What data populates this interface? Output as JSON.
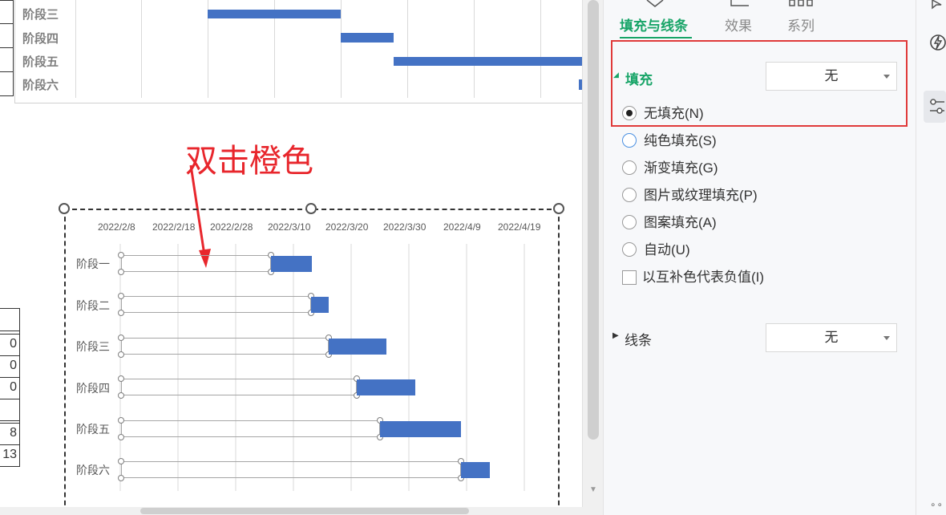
{
  "top_chart": {
    "labels": [
      "阶段三",
      "阶段四",
      "阶段五",
      "阶段六"
    ]
  },
  "sheet": {
    "values": [
      "0",
      "0",
      "0",
      "8",
      "13"
    ]
  },
  "annotation": {
    "text": "双击橙色"
  },
  "chart": {
    "x_ticks": [
      "2022/2/8",
      "2022/2/18",
      "2022/2/28",
      "2022/3/10",
      "2022/3/20",
      "2022/3/30",
      "2022/4/9",
      "2022/4/19"
    ],
    "y_labels": [
      "阶段一",
      "阶段二",
      "阶段三",
      "阶段四",
      "阶段五",
      "阶段六"
    ]
  },
  "chart_data": {
    "type": "bar",
    "orientation": "horizontal stacked (gantt)",
    "categories": [
      "阶段一",
      "阶段二",
      "阶段三",
      "阶段四",
      "阶段五",
      "阶段六"
    ],
    "x_ticks": [
      "2022/2/8",
      "2022/2/18",
      "2022/2/28",
      "2022/3/10",
      "2022/3/20",
      "2022/3/30",
      "2022/4/9",
      "2022/4/19"
    ],
    "xlim": [
      "2022/2/8",
      "2022/4/25"
    ],
    "series": [
      {
        "values": [
          "2022/3/6",
          "2022/3/13",
          "2022/3/16",
          "2022/3/21",
          "2022/3/25",
          "2022/4/10"
        ],
        "fill": "none"
      },
      {
        "values_days": [
          7,
          3,
          10,
          10,
          14,
          5
        ],
        "color": "#4472c4"
      }
    ],
    "grid": true
  },
  "pane": {
    "tabs": [
      "填充与线条",
      "效果",
      "系列"
    ],
    "fill_title": "填充",
    "fill_value": "无",
    "options": [
      "无填充(N)",
      "纯色填充(S)",
      "渐变填充(G)",
      "图片或纹理填充(P)",
      "图案填充(A)",
      "自动(U)"
    ],
    "checkbox_label": "以互补色代表负值(I)",
    "line_title": "线条",
    "line_value": "无"
  },
  "colors": {
    "accent": "#17a467",
    "bar": "#4472c4",
    "annotation": "#e8262c",
    "highlight": "#e03a3a"
  }
}
